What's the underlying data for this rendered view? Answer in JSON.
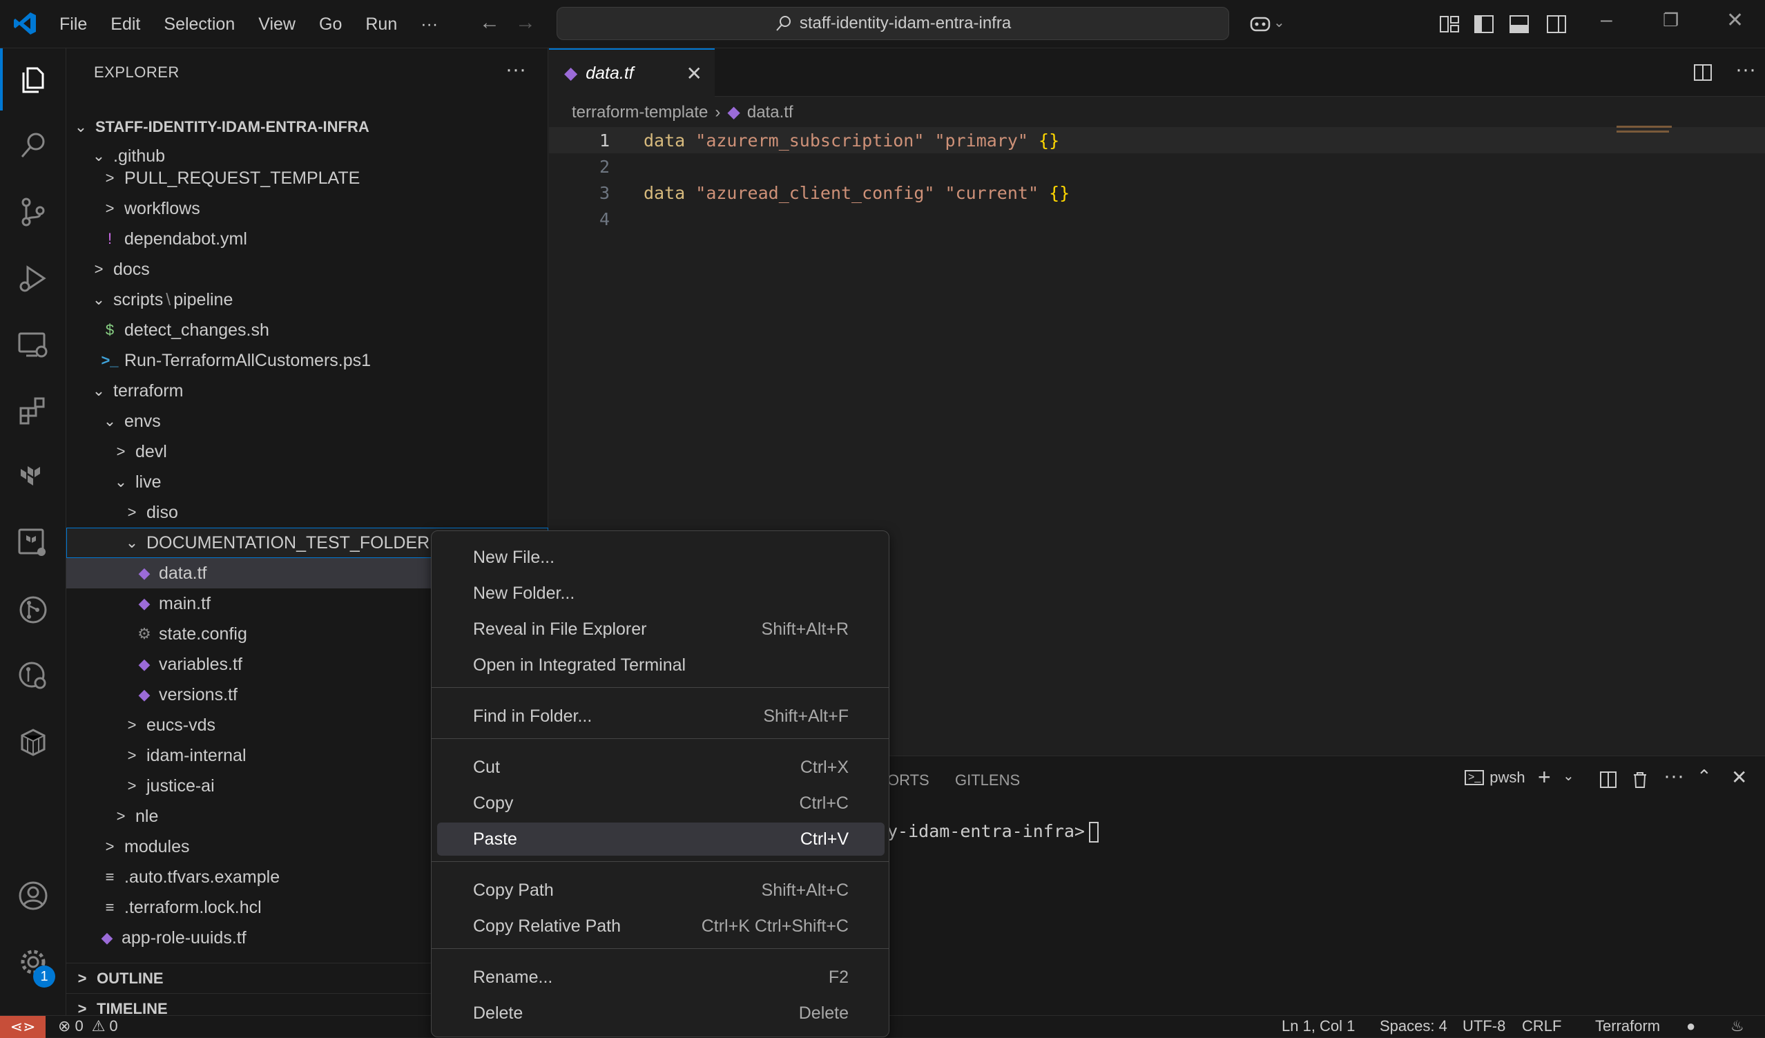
{
  "titlebar": {
    "menu": [
      "File",
      "Edit",
      "Selection",
      "View",
      "Go",
      "Run"
    ],
    "more": "···",
    "search_text": "staff-identity-idam-entra-infra"
  },
  "sidebar": {
    "title": "EXPLORER",
    "more": "···",
    "root": "STAFF-IDENTITY-IDAM-ENTRA-INFRA",
    "rows": [
      {
        "label": ".github",
        "chev": "⌵"
      },
      {
        "label": "PULL_REQUEST_TEMPLATE",
        "chev": ">"
      },
      {
        "label": "workflows",
        "chev": ">"
      },
      {
        "label": "dependabot.yml",
        "icon": "!"
      },
      {
        "label": "docs",
        "chev": ">"
      },
      {
        "label": "scripts",
        "sep": "\\",
        "label2": "pipeline",
        "chev": "⌵"
      },
      {
        "label": "detect_changes.sh",
        "icon": "$"
      },
      {
        "label": "Run-TerraformAllCustomers.ps1",
        "icon": ">_"
      },
      {
        "label": "terraform",
        "chev": "⌵"
      },
      {
        "label": "envs",
        "chev": "⌵"
      },
      {
        "label": "devl",
        "chev": ">"
      },
      {
        "label": "live",
        "chev": "⌵"
      },
      {
        "label": "diso",
        "chev": ">"
      },
      {
        "label": "DOCUMENTATION_TEST_FOLDER",
        "chev": "⌵"
      },
      {
        "label": "data.tf"
      },
      {
        "label": "main.tf"
      },
      {
        "label": "state.config",
        "icon": "⚙"
      },
      {
        "label": "variables.tf"
      },
      {
        "label": "versions.tf"
      },
      {
        "label": "eucs-vds",
        "chev": ">"
      },
      {
        "label": "idam-internal",
        "chev": ">"
      },
      {
        "label": "justice-ai",
        "chev": ">"
      },
      {
        "label": "nle",
        "chev": ">"
      },
      {
        "label": "modules",
        "chev": ">"
      },
      {
        "label": ".auto.tfvars.example",
        "icon": "≡"
      },
      {
        "label": ".terraform.lock.hcl",
        "icon": "≡"
      },
      {
        "label": "app-role-uuids.tf"
      }
    ],
    "outline": "OUTLINE",
    "timeline": "TIMELINE"
  },
  "editor": {
    "tab_label": "data.tf",
    "breadcrumb": [
      "terraform-template",
      "data.tf"
    ],
    "lines": [
      {
        "n": "1",
        "kw": "data",
        "s1": "\"azurerm_subscription\"",
        "s2": "\"primary\"",
        "br": "{}"
      },
      {
        "n": "2"
      },
      {
        "n": "3",
        "kw": "data",
        "s1": "\"azuread_client_config\"",
        "s2": "\"current\"",
        "br": "{}"
      },
      {
        "n": "4"
      }
    ]
  },
  "panel": {
    "tabs": [
      "ORTS",
      "GITLENS"
    ],
    "shell": "pwsh",
    "terminal_text": "y-idam-entra-infra>"
  },
  "context_menu": {
    "items": [
      {
        "label": "New File...",
        "key": ""
      },
      {
        "label": "New Folder...",
        "key": ""
      },
      {
        "label": "Reveal in File Explorer",
        "key": "Shift+Alt+R"
      },
      {
        "label": "Open in Integrated Terminal",
        "key": ""
      },
      {
        "label": "Find in Folder...",
        "key": "Shift+Alt+F"
      },
      {
        "label": "Cut",
        "key": "Ctrl+X"
      },
      {
        "label": "Copy",
        "key": "Ctrl+C"
      },
      {
        "label": "Paste",
        "key": "Ctrl+V"
      },
      {
        "label": "Copy Path",
        "key": "Shift+Alt+C"
      },
      {
        "label": "Copy Relative Path",
        "key": "Ctrl+K Ctrl+Shift+C"
      },
      {
        "label": "Rename...",
        "key": "F2"
      },
      {
        "label": "Delete",
        "key": "Delete"
      }
    ]
  },
  "statusbar": {
    "errors": "0",
    "warnings": "0",
    "position": "Ln 1, Col 1",
    "spaces": "Spaces: 4",
    "encoding": "UTF-8",
    "eol": "CRLF",
    "language": "Terraform"
  },
  "badge_count": "1",
  "colors": {
    "accent": "#0078d4",
    "terraform": "#7b42bc",
    "remote": "#c74e39"
  }
}
